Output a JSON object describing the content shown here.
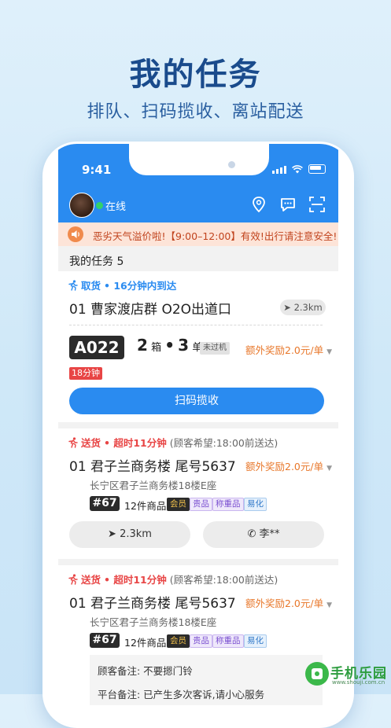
{
  "promo": {
    "title": "我的任务",
    "subtitle": "排队、扫码揽收、离站配送"
  },
  "status_bar": {
    "time": "9:41"
  },
  "app_bar": {
    "online_label": "在线",
    "icons": [
      "location-pin-icon",
      "chat-bubble-icon",
      "scan-icon"
    ]
  },
  "notice": {
    "text": "恶劣天气溢价啦!【9:00–12:00】有效!出行请注意安全!"
  },
  "section": {
    "label": "我的任务 5"
  },
  "card1": {
    "status_label": "取货",
    "status_detail": "• 16分钟内到达",
    "address": "01  曹家渡店群 O2O出道口",
    "distance": "2.3km",
    "code": "A022",
    "boxes_num": "2",
    "boxes_unit": "箱",
    "dot": "•",
    "orders_num": "3",
    "orders_unit": "单",
    "badge": "未过机",
    "bonus": "额外奖励2.0元/单",
    "time_badge": "18分钟",
    "button": "扫码揽收"
  },
  "card2": {
    "status_label": "送货",
    "status_detail": "• 超时11分钟",
    "hope": "(顾客希望:18:00前送达)",
    "address": "01  君子兰商务楼 尾号5637",
    "bonus": "额外奖励2.0元/单",
    "sub_address": "长宁区君子兰商务楼18楼E座",
    "num": "#67",
    "items": "12件商品",
    "labels": [
      "会员",
      "贵品",
      "称重品",
      "易化"
    ],
    "distance_button": "2.3km",
    "phone_button": "李**"
  },
  "card3": {
    "status_label": "送货",
    "status_detail": "• 超时11分钟",
    "hope": "(顾客希望:18:00前送达)",
    "address": "01  君子兰商务楼 尾号5637",
    "bonus": "额外奖励2.0元/单",
    "sub_address": "长宁区君子兰商务楼18楼E座",
    "num": "#67",
    "items": "12件商品",
    "labels": [
      "会员",
      "贵品",
      "称重品",
      "易化"
    ],
    "note1": "顾客备注:  不要摁门铃",
    "note2": "平台备注:  已产生多次客诉,请小心服务"
  },
  "watermark": {
    "text": "手机乐园",
    "url": "www.shouji.com.cn"
  },
  "colors": {
    "primary": "#2a8bf0",
    "bonus_orange": "#e8772a",
    "alert_red": "#e84545",
    "notice_bg": "#fde4d8"
  }
}
